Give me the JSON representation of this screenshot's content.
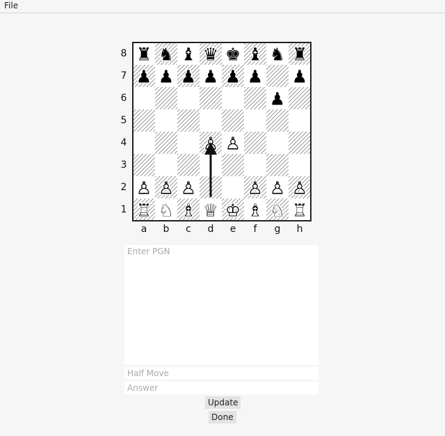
{
  "menu": {
    "file_label": "File"
  },
  "board": {
    "ranks": [
      "8",
      "7",
      "6",
      "5",
      "4",
      "3",
      "2",
      "1"
    ],
    "files": [
      "a",
      "b",
      "c",
      "d",
      "e",
      "f",
      "g",
      "h"
    ],
    "position": [
      [
        "♜",
        "♞",
        "♝",
        "♛",
        "♚",
        "♝",
        "♞",
        "♜"
      ],
      [
        "♟",
        "♟",
        "♟",
        "♟",
        "♟",
        "♟",
        "",
        "♟"
      ],
      [
        "",
        "",
        "",
        "",
        "",
        "",
        "♟",
        ""
      ],
      [
        "",
        "",
        "",
        "",
        "",
        "",
        "",
        ""
      ],
      [
        "",
        "",
        "",
        "♙",
        "♙",
        "",
        "",
        ""
      ],
      [
        "",
        "",
        "",
        "",
        "",
        "",
        "",
        ""
      ],
      [
        "♙",
        "♙",
        "♙",
        "",
        "",
        "♙",
        "♙",
        "♙"
      ],
      [
        "♖",
        "♘",
        "♗",
        "♕",
        "♔",
        "♗",
        "♘",
        "♖"
      ]
    ],
    "arrow": {
      "from": "d2",
      "to": "d4"
    },
    "colors": {
      "light": "#ffffff",
      "hatch": "#555555",
      "border": "#222222",
      "arrow": "#111111"
    }
  },
  "pgn": {
    "placeholder": "Enter PGN",
    "value": ""
  },
  "half_move": {
    "placeholder": "Half Move",
    "value": ""
  },
  "answer": {
    "placeholder": "Answer",
    "value": ""
  },
  "buttons": {
    "update": "Update",
    "done": "Done"
  }
}
